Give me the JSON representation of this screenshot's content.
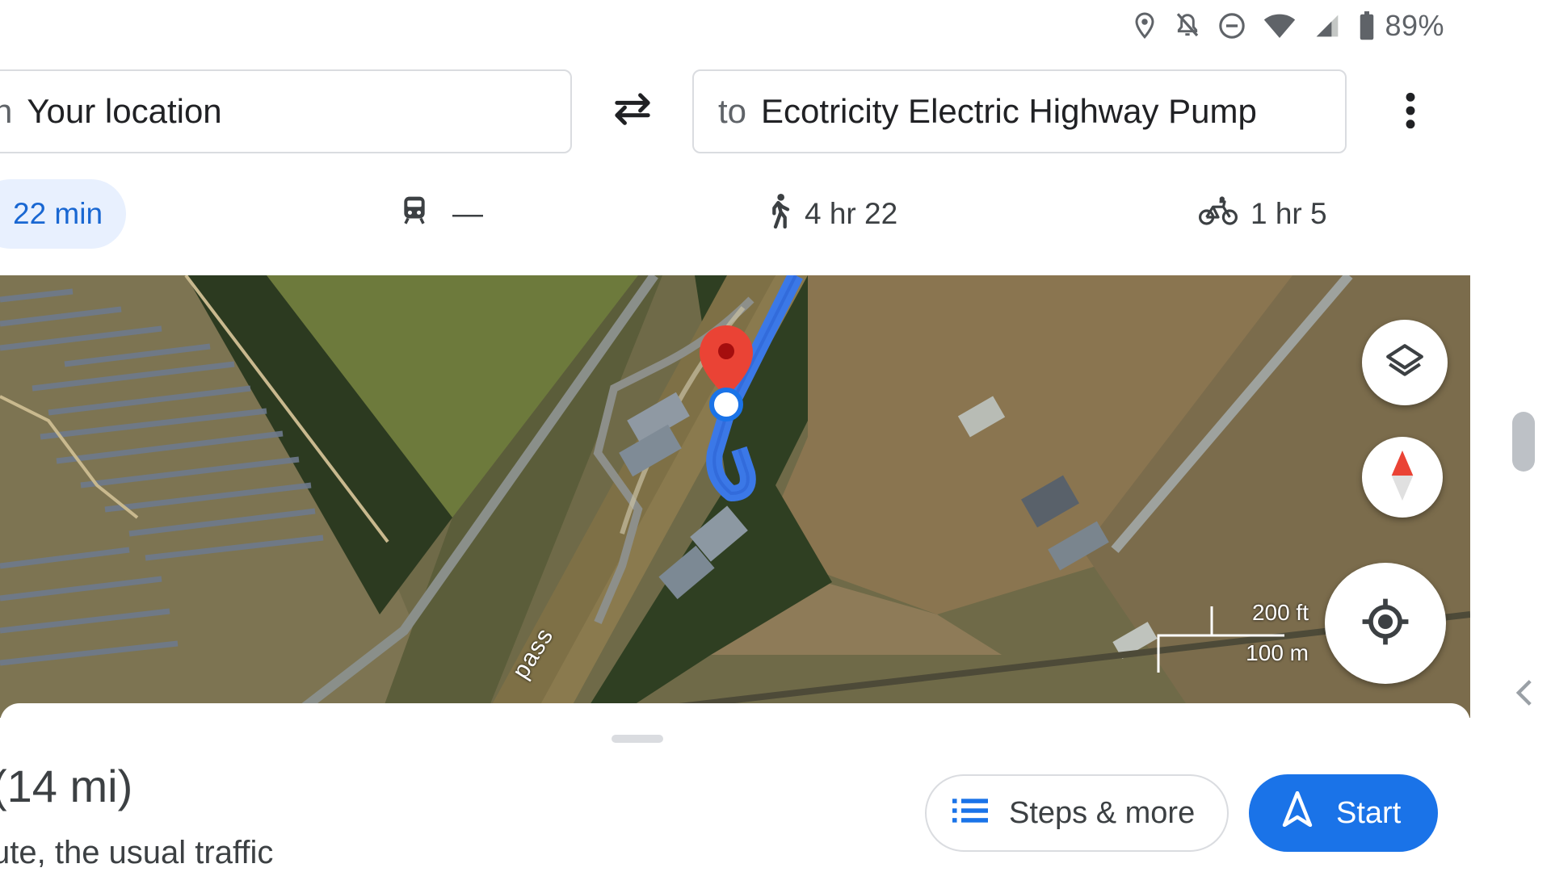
{
  "status_bar": {
    "icons": [
      "location-icon",
      "notifications-off-icon",
      "do-not-disturb-icon",
      "wifi-icon",
      "cellular-signal-icon",
      "battery-icon"
    ],
    "battery": "89%"
  },
  "route": {
    "origin_prefix": "n",
    "origin": "Your location",
    "destination_prefix": "to",
    "destination": "Ecotricity Electric Highway Pump"
  },
  "modes": {
    "drive": "22 min",
    "transit": "—",
    "walk": "4 hr 22",
    "bike": "1 hr 5"
  },
  "map": {
    "road_label": "pass",
    "scale_ft": "200 ft",
    "scale_m": "100 m"
  },
  "summary": {
    "distance": "(14 mi)",
    "traffic": "ute, the usual traffic"
  },
  "actions": {
    "steps": "Steps & more",
    "start": "Start"
  },
  "colors": {
    "accent": "#1a73e8",
    "route": "#4285f4",
    "pin": "#ea4335",
    "mode_selected_bg": "#e8f0fe"
  }
}
